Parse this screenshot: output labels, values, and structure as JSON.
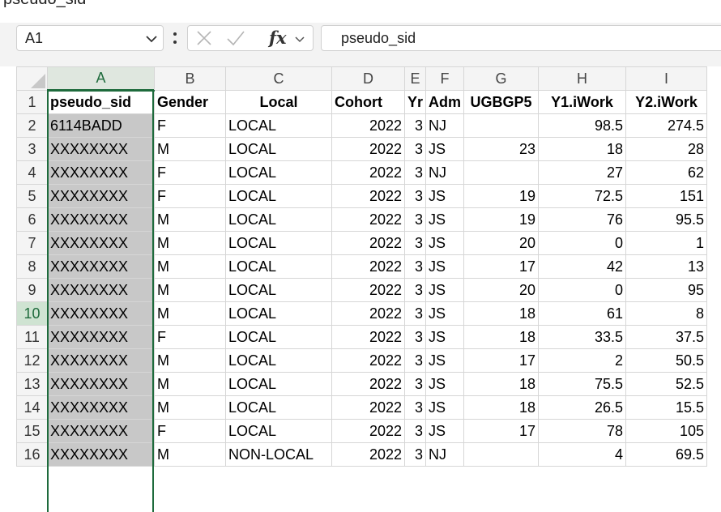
{
  "top_strip_text": "pseudo_sid",
  "name_box": {
    "value": "A1"
  },
  "formula_bar": {
    "fx_label": "fx",
    "value": "pseudo_sid"
  },
  "columns": [
    "A",
    "B",
    "C",
    "D",
    "E",
    "F",
    "G",
    "H",
    "I"
  ],
  "selected_column": "A",
  "selected_row": "10",
  "header_row": {
    "row": "1",
    "cells": [
      "pseudo_sid",
      "Gender",
      "Local",
      "Cohort",
      "Yr",
      "Adm",
      "UGBGP5",
      "Y1.iWork",
      "Y2.iWork"
    ]
  },
  "rows": [
    {
      "row": "2",
      "cells": [
        "6114BADD",
        "F",
        "LOCAL",
        "2022",
        "3",
        "NJ",
        "",
        "98.5",
        "274.5"
      ]
    },
    {
      "row": "3",
      "cells": [
        "XXXXXXXX",
        "M",
        "LOCAL",
        "2022",
        "3",
        "JS",
        "23",
        "18",
        "28"
      ]
    },
    {
      "row": "4",
      "cells": [
        "XXXXXXXX",
        "F",
        "LOCAL",
        "2022",
        "3",
        "NJ",
        "",
        "27",
        "62"
      ]
    },
    {
      "row": "5",
      "cells": [
        "XXXXXXXX",
        "F",
        "LOCAL",
        "2022",
        "3",
        "JS",
        "19",
        "72.5",
        "151"
      ]
    },
    {
      "row": "6",
      "cells": [
        "XXXXXXXX",
        "M",
        "LOCAL",
        "2022",
        "3",
        "JS",
        "19",
        "76",
        "95.5"
      ]
    },
    {
      "row": "7",
      "cells": [
        "XXXXXXXX",
        "M",
        "LOCAL",
        "2022",
        "3",
        "JS",
        "20",
        "0",
        "1"
      ]
    },
    {
      "row": "8",
      "cells": [
        "XXXXXXXX",
        "M",
        "LOCAL",
        "2022",
        "3",
        "JS",
        "17",
        "42",
        "13"
      ]
    },
    {
      "row": "9",
      "cells": [
        "XXXXXXXX",
        "M",
        "LOCAL",
        "2022",
        "3",
        "JS",
        "20",
        "0",
        "95"
      ]
    },
    {
      "row": "10",
      "cells": [
        "XXXXXXXX",
        "M",
        "LOCAL",
        "2022",
        "3",
        "JS",
        "18",
        "61",
        "8"
      ]
    },
    {
      "row": "11",
      "cells": [
        "XXXXXXXX",
        "F",
        "LOCAL",
        "2022",
        "3",
        "JS",
        "18",
        "33.5",
        "37.5"
      ]
    },
    {
      "row": "12",
      "cells": [
        "XXXXXXXX",
        "M",
        "LOCAL",
        "2022",
        "3",
        "JS",
        "17",
        "2",
        "50.5"
      ]
    },
    {
      "row": "13",
      "cells": [
        "XXXXXXXX",
        "M",
        "LOCAL",
        "2022",
        "3",
        "JS",
        "18",
        "75.5",
        "52.5"
      ]
    },
    {
      "row": "14",
      "cells": [
        "XXXXXXXX",
        "M",
        "LOCAL",
        "2022",
        "3",
        "JS",
        "18",
        "26.5",
        "15.5"
      ]
    },
    {
      "row": "15",
      "cells": [
        "XXXXXXXX",
        "F",
        "LOCAL",
        "2022",
        "3",
        "JS",
        "17",
        "78",
        "105"
      ]
    },
    {
      "row": "16",
      "cells": [
        "XXXXXXXX",
        "M",
        "NON-LOCAL",
        "2022",
        "3",
        "NJ",
        "",
        "4",
        "69.5"
      ]
    }
  ],
  "colors": {
    "accent": "#1e6b3c",
    "selected_column_fill": "#c8c8c8",
    "header_fill": "#f4f4f4"
  },
  "icons": [
    "chevron-down-icon",
    "more-options-icon",
    "cancel-icon",
    "confirm-icon",
    "insert-function-icon"
  ]
}
